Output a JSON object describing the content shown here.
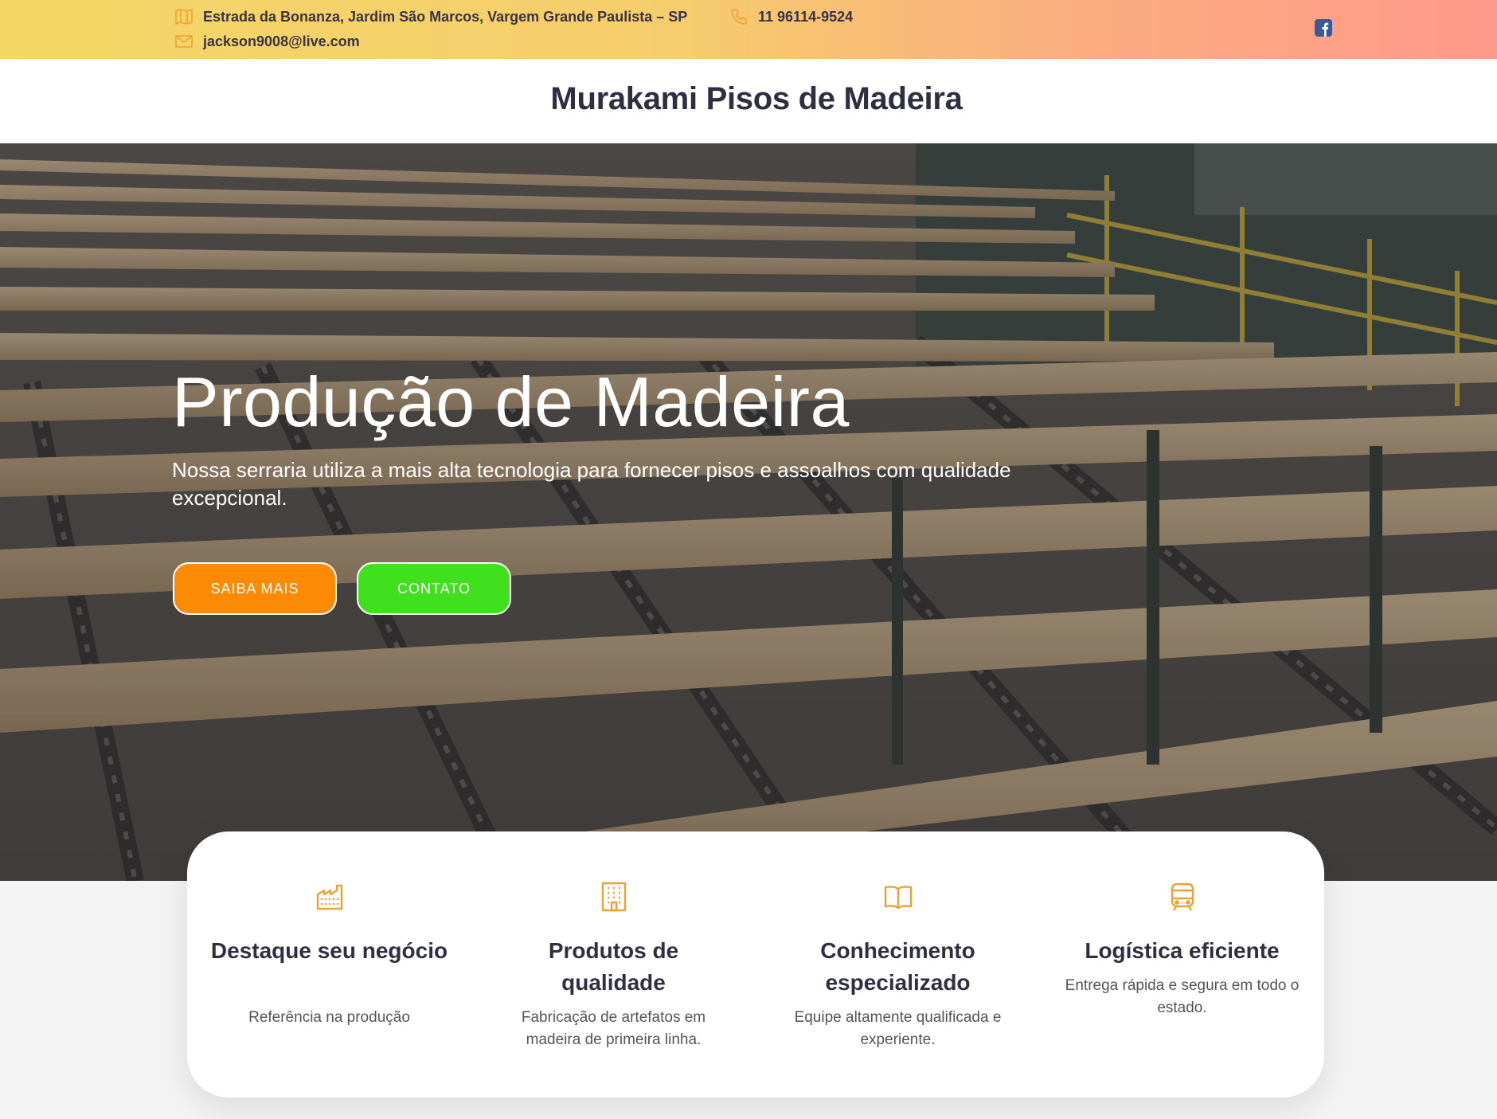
{
  "topbar": {
    "address": "Estrada da Bonanza, Jardim São Marcos, Vargem Grande Paulista – SP",
    "phone": "11 96114-9524",
    "email": "jackson9008@live.com",
    "icons": [
      "map-icon",
      "phone-icon",
      "mail-icon",
      "facebook-icon"
    ]
  },
  "header": {
    "site_title": "Murakami Pisos de Madeira"
  },
  "hero": {
    "title": "Produção de Madeira",
    "subtitle": "Nossa serraria utiliza a mais alta tecnologia para fornecer pisos e assoalhos com qualidade excepcional.",
    "buttons": [
      {
        "label": "SAIBA MAIS",
        "color": "#fd8a05"
      },
      {
        "label": "CONTATO",
        "color": "#40e01e"
      }
    ]
  },
  "features": [
    {
      "icon": "factory-icon",
      "title": "Destaque seu negócio",
      "description": "Referência na produção"
    },
    {
      "icon": "building-icon",
      "title": "Produtos de qualidade",
      "description": "Fabricação de artefatos em madeira de primeira linha."
    },
    {
      "icon": "book-icon",
      "title": "Conhecimento especializado",
      "description": "Equipe altamente qualificada e experiente."
    },
    {
      "icon": "train-icon",
      "title": "Logística eficiente",
      "description": "Entrega rápida e segura em todo o estado."
    }
  ],
  "colors": {
    "topbar_gradient_start": "#f4d766",
    "topbar_gradient_end": "#fe9a8a",
    "icon_accent": "#f0a030",
    "title_text": "#2f2f44"
  }
}
